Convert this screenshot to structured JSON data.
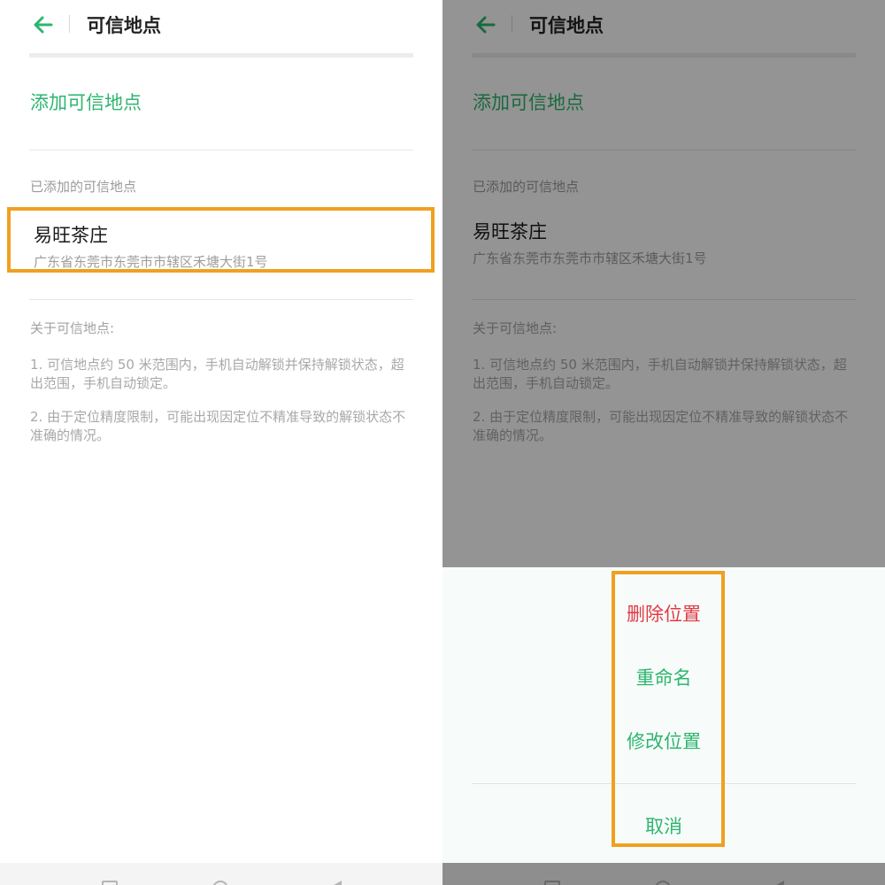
{
  "screen": {
    "title": "可信地点",
    "add_place": "添加可信地点",
    "added_section_label": "已添加的可信地点",
    "places": [
      {
        "name": "易旺茶庄",
        "address": "广东省东莞市东莞市市辖区禾塘大街1号"
      }
    ],
    "about_title": "关于可信地点:",
    "notes": [
      "1. 可信地点约 50 米范围内，手机自动解锁并保持解锁状态，超出范围，手机自动锁定。",
      "2. 由于定位精度限制，可能出现因定位不精准导致的解锁状态不准确的情况。"
    ]
  },
  "action_sheet": {
    "delete": "删除位置",
    "rename": "重命名",
    "modify": "修改位置",
    "cancel": "取消"
  },
  "colors": {
    "accent": "#2eb56f",
    "danger": "#e23a44",
    "highlight": "#f0a020"
  },
  "icons": {
    "back": "back-arrow-icon",
    "nav_recent": "recent-apps-icon",
    "nav_home": "home-icon",
    "nav_back": "nav-back-icon"
  }
}
